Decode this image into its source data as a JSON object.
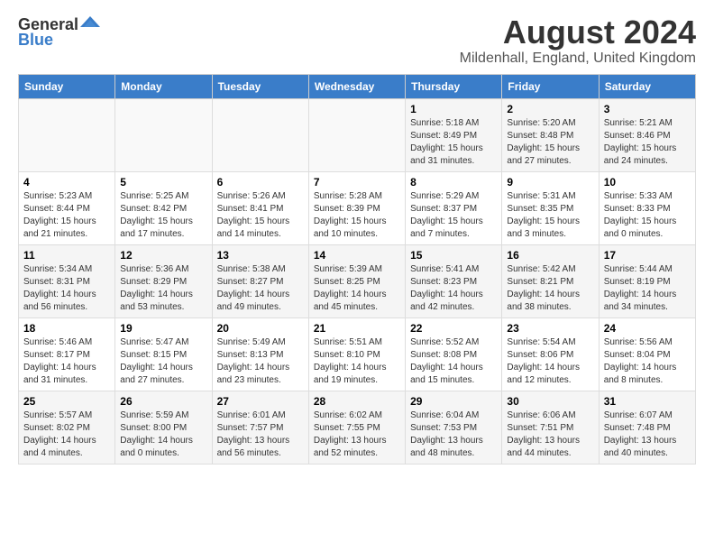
{
  "header": {
    "logo_general": "General",
    "logo_blue": "Blue",
    "title": "August 2024",
    "subtitle": "Mildenhall, England, United Kingdom"
  },
  "columns": [
    "Sunday",
    "Monday",
    "Tuesday",
    "Wednesday",
    "Thursday",
    "Friday",
    "Saturday"
  ],
  "weeks": [
    [
      {
        "day": "",
        "text": ""
      },
      {
        "day": "",
        "text": ""
      },
      {
        "day": "",
        "text": ""
      },
      {
        "day": "",
        "text": ""
      },
      {
        "day": "1",
        "text": "Sunrise: 5:18 AM\nSunset: 8:49 PM\nDaylight: 15 hours\nand 31 minutes."
      },
      {
        "day": "2",
        "text": "Sunrise: 5:20 AM\nSunset: 8:48 PM\nDaylight: 15 hours\nand 27 minutes."
      },
      {
        "day": "3",
        "text": "Sunrise: 5:21 AM\nSunset: 8:46 PM\nDaylight: 15 hours\nand 24 minutes."
      }
    ],
    [
      {
        "day": "4",
        "text": "Sunrise: 5:23 AM\nSunset: 8:44 PM\nDaylight: 15 hours\nand 21 minutes."
      },
      {
        "day": "5",
        "text": "Sunrise: 5:25 AM\nSunset: 8:42 PM\nDaylight: 15 hours\nand 17 minutes."
      },
      {
        "day": "6",
        "text": "Sunrise: 5:26 AM\nSunset: 8:41 PM\nDaylight: 15 hours\nand 14 minutes."
      },
      {
        "day": "7",
        "text": "Sunrise: 5:28 AM\nSunset: 8:39 PM\nDaylight: 15 hours\nand 10 minutes."
      },
      {
        "day": "8",
        "text": "Sunrise: 5:29 AM\nSunset: 8:37 PM\nDaylight: 15 hours\nand 7 minutes."
      },
      {
        "day": "9",
        "text": "Sunrise: 5:31 AM\nSunset: 8:35 PM\nDaylight: 15 hours\nand 3 minutes."
      },
      {
        "day": "10",
        "text": "Sunrise: 5:33 AM\nSunset: 8:33 PM\nDaylight: 15 hours\nand 0 minutes."
      }
    ],
    [
      {
        "day": "11",
        "text": "Sunrise: 5:34 AM\nSunset: 8:31 PM\nDaylight: 14 hours\nand 56 minutes."
      },
      {
        "day": "12",
        "text": "Sunrise: 5:36 AM\nSunset: 8:29 PM\nDaylight: 14 hours\nand 53 minutes."
      },
      {
        "day": "13",
        "text": "Sunrise: 5:38 AM\nSunset: 8:27 PM\nDaylight: 14 hours\nand 49 minutes."
      },
      {
        "day": "14",
        "text": "Sunrise: 5:39 AM\nSunset: 8:25 PM\nDaylight: 14 hours\nand 45 minutes."
      },
      {
        "day": "15",
        "text": "Sunrise: 5:41 AM\nSunset: 8:23 PM\nDaylight: 14 hours\nand 42 minutes."
      },
      {
        "day": "16",
        "text": "Sunrise: 5:42 AM\nSunset: 8:21 PM\nDaylight: 14 hours\nand 38 minutes."
      },
      {
        "day": "17",
        "text": "Sunrise: 5:44 AM\nSunset: 8:19 PM\nDaylight: 14 hours\nand 34 minutes."
      }
    ],
    [
      {
        "day": "18",
        "text": "Sunrise: 5:46 AM\nSunset: 8:17 PM\nDaylight: 14 hours\nand 31 minutes."
      },
      {
        "day": "19",
        "text": "Sunrise: 5:47 AM\nSunset: 8:15 PM\nDaylight: 14 hours\nand 27 minutes."
      },
      {
        "day": "20",
        "text": "Sunrise: 5:49 AM\nSunset: 8:13 PM\nDaylight: 14 hours\nand 23 minutes."
      },
      {
        "day": "21",
        "text": "Sunrise: 5:51 AM\nSunset: 8:10 PM\nDaylight: 14 hours\nand 19 minutes."
      },
      {
        "day": "22",
        "text": "Sunrise: 5:52 AM\nSunset: 8:08 PM\nDaylight: 14 hours\nand 15 minutes."
      },
      {
        "day": "23",
        "text": "Sunrise: 5:54 AM\nSunset: 8:06 PM\nDaylight: 14 hours\nand 12 minutes."
      },
      {
        "day": "24",
        "text": "Sunrise: 5:56 AM\nSunset: 8:04 PM\nDaylight: 14 hours\nand 8 minutes."
      }
    ],
    [
      {
        "day": "25",
        "text": "Sunrise: 5:57 AM\nSunset: 8:02 PM\nDaylight: 14 hours\nand 4 minutes."
      },
      {
        "day": "26",
        "text": "Sunrise: 5:59 AM\nSunset: 8:00 PM\nDaylight: 14 hours\nand 0 minutes."
      },
      {
        "day": "27",
        "text": "Sunrise: 6:01 AM\nSunset: 7:57 PM\nDaylight: 13 hours\nand 56 minutes."
      },
      {
        "day": "28",
        "text": "Sunrise: 6:02 AM\nSunset: 7:55 PM\nDaylight: 13 hours\nand 52 minutes."
      },
      {
        "day": "29",
        "text": "Sunrise: 6:04 AM\nSunset: 7:53 PM\nDaylight: 13 hours\nand 48 minutes."
      },
      {
        "day": "30",
        "text": "Sunrise: 6:06 AM\nSunset: 7:51 PM\nDaylight: 13 hours\nand 44 minutes."
      },
      {
        "day": "31",
        "text": "Sunrise: 6:07 AM\nSunset: 7:48 PM\nDaylight: 13 hours\nand 40 minutes."
      }
    ]
  ]
}
